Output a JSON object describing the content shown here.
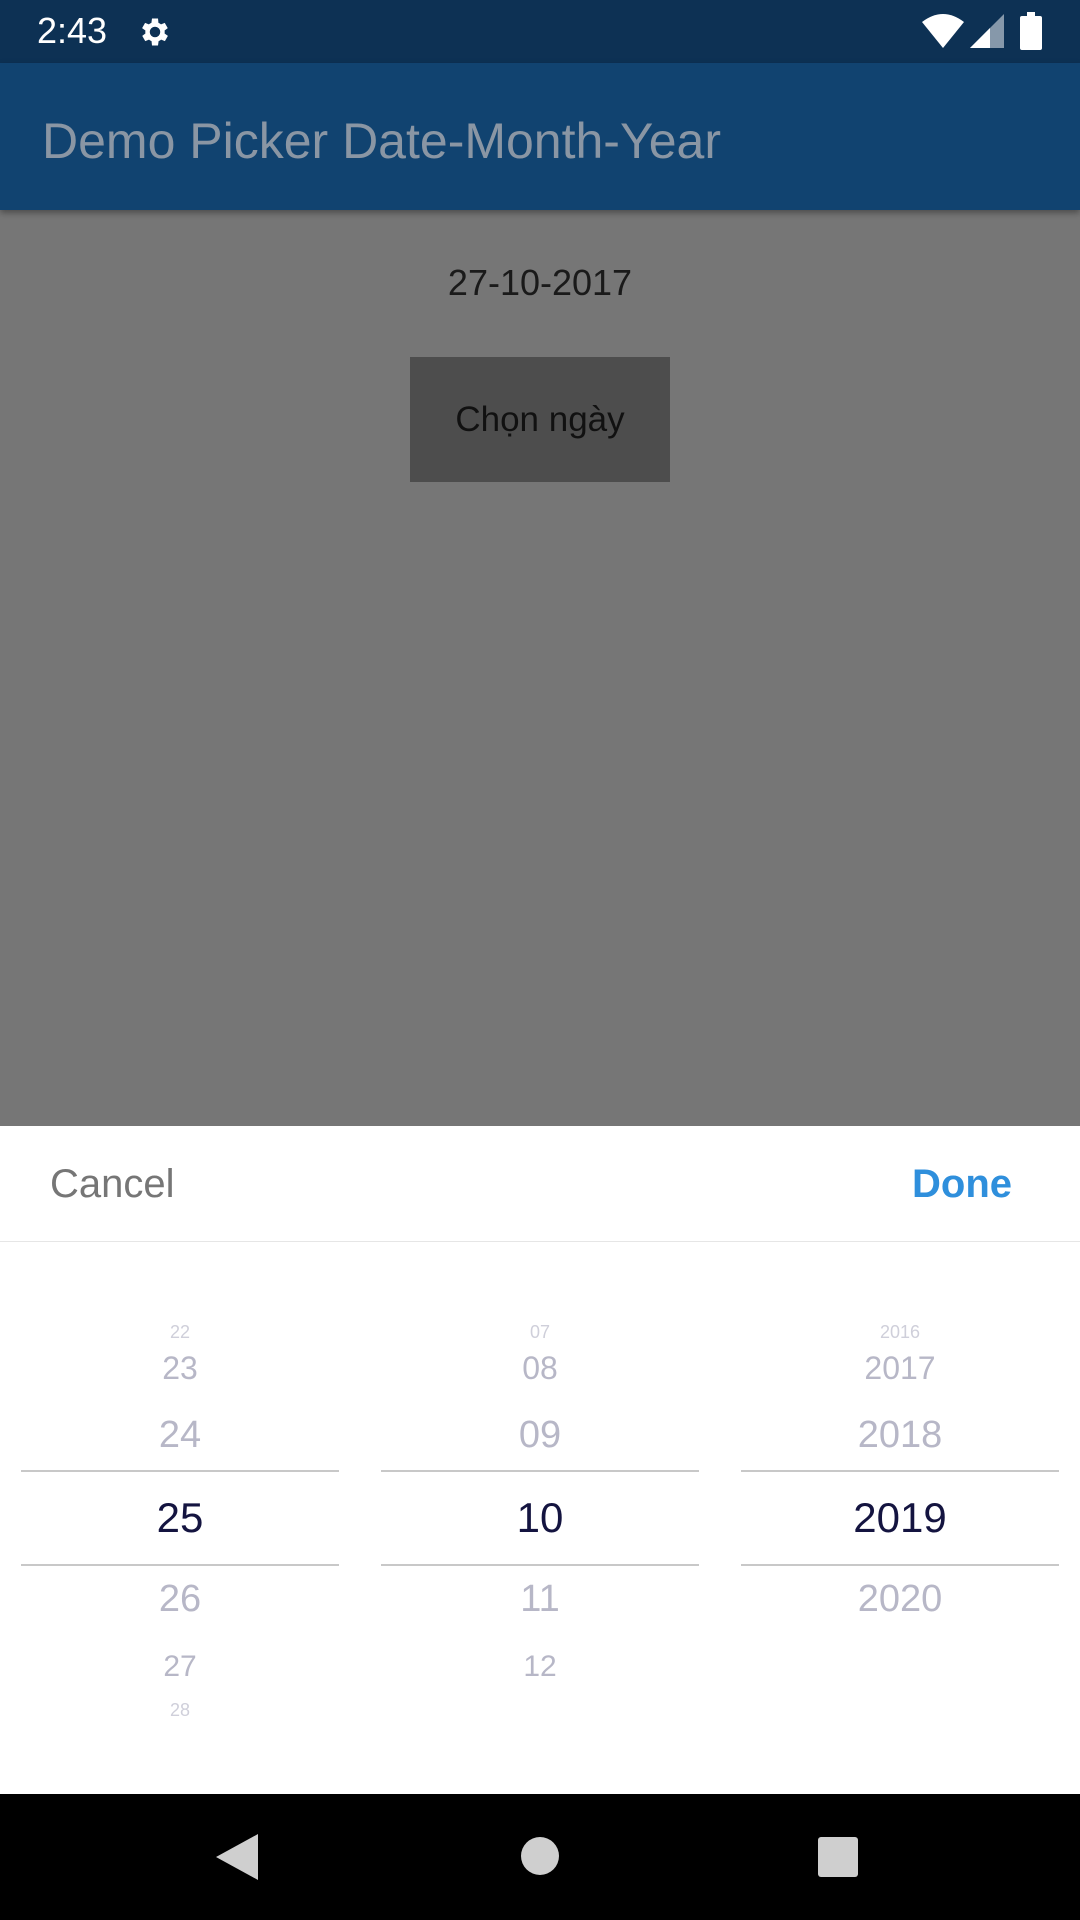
{
  "status_bar": {
    "time": "2:43",
    "icons": [
      "gear-icon",
      "wifi-icon",
      "signal-icon",
      "battery-icon"
    ]
  },
  "app_bar": {
    "title": "Demo Picker Date-Month-Year"
  },
  "content": {
    "selected_date": "27-10-2017",
    "pick_button_label": "Chọn ngày"
  },
  "sheet": {
    "cancel_label": "Cancel",
    "done_label": "Done",
    "day_wheel": {
      "above": [
        "22",
        "23",
        "24"
      ],
      "selected": "25",
      "below": [
        "26",
        "27",
        "28"
      ]
    },
    "month_wheel": {
      "above": [
        "07",
        "08",
        "09"
      ],
      "selected": "10",
      "below": [
        "11",
        "12"
      ]
    },
    "year_wheel": {
      "above": [
        "2016",
        "2017",
        "2018"
      ],
      "selected": "2019",
      "below": [
        "2020"
      ]
    }
  },
  "nav_bar": {
    "icons": [
      "back-icon",
      "home-icon",
      "recents-icon"
    ]
  },
  "colors": {
    "status_bar": "#0d3154",
    "app_bar": "#114370",
    "overlay": "#767676",
    "done": "#2f8fdc",
    "selected_text": "#141440"
  }
}
